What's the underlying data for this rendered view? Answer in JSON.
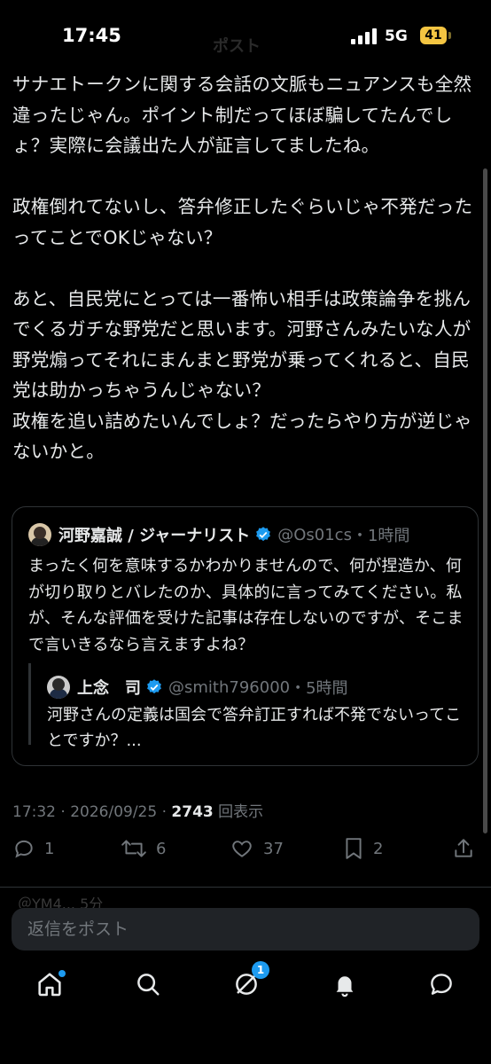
{
  "status_bar": {
    "time": "17:45",
    "network": "5G",
    "battery": "41",
    "header_peek": "ポスト"
  },
  "post": {
    "text": "サナエトークンに関する会話の文脈もニュアンスも全然違ったじゃん。ポイント制だってほぼ騙してたんでしょ？実際に会議出た人が証言してましたね。\n\n政権倒れてないし、答弁修正したぐらいじゃ不発だったってことでOKじゃない？\n\nあと、自民党にとっては一番怖い相手は政策論争を挑んでくるガチな野党だと思います。河野さんみたいな人が野党煽ってそれにまんまと野党が乗ってくれると、自民党は助かっちゃうんじゃない？\n政権を追い詰めたいんでしょ？だったらやり方が逆じゃないかと。"
  },
  "quote": {
    "name": "河野嘉誠 / ジャーナリスト",
    "handle": "@Os01cs",
    "time": "・1時間",
    "text": "まったく何を意味するかわかりませんので、何が捏造か、何が切り取りとバレたのか、具体的に言ってみてください。私が、そんな評価を受けた記事は存在しないのですが、そこまで言いきるなら言えますよね？",
    "nested": {
      "name": "上念　司",
      "handle": "@smith796000",
      "time": "・5時間",
      "text": "河野さんの定義は国会で答弁訂正すれば不発でないってことですか？..."
    }
  },
  "meta": {
    "timestamp": "17:32 · 2026/09/25 · ",
    "views": "2743",
    "views_label": " 回表示"
  },
  "actions": {
    "reply_count": "1",
    "repost_count": "6",
    "like_count": "37",
    "bookmark_count": "2"
  },
  "next_reply_peek": "＠YM4... 5分",
  "composer": {
    "placeholder": "返信をポスト"
  },
  "tabbar": {
    "messages_badge": "1"
  },
  "colors": {
    "background": "#000000",
    "text": "#e7e9ea",
    "muted": "#71767b",
    "accent": "#1d9bf0",
    "battery": "#f4c542"
  }
}
